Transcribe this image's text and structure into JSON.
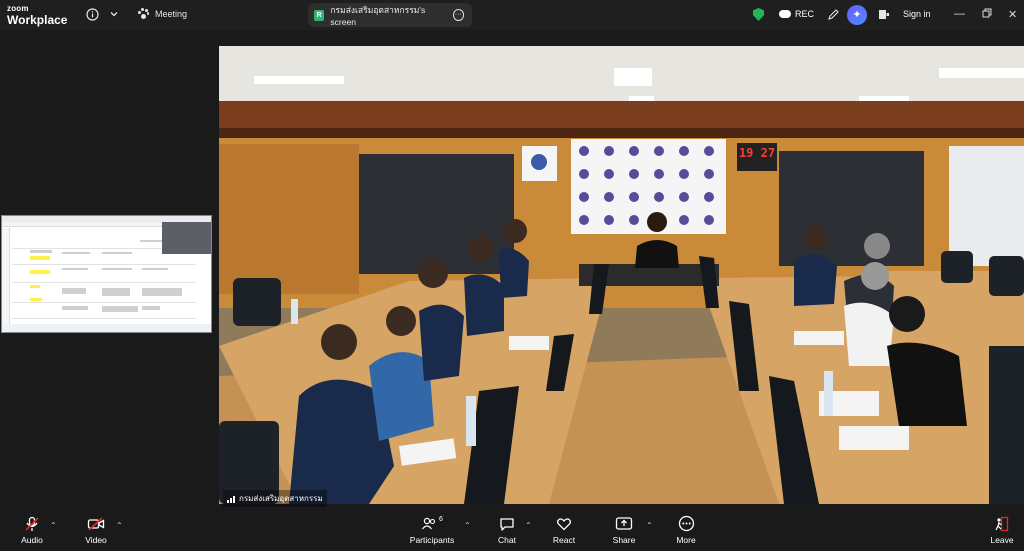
{
  "app": {
    "logo_line1": "zoom",
    "logo_line2": "Workplace"
  },
  "topbar": {
    "meeting_label": "Meeting",
    "share_badge": "R",
    "share_title": "กรมส่งเสริมอุตสาหกรรม's screen",
    "rec_label": "REC",
    "sign_in": "Sign in"
  },
  "video": {
    "participant_name": "กรมส่งเสริมอุตสาหกรรม",
    "clock": "19 27"
  },
  "toolbar": {
    "audio": "Audio",
    "video": "Video",
    "participants": "Participants",
    "participants_count": "6",
    "chat": "Chat",
    "react": "React",
    "share": "Share",
    "more": "More",
    "leave": "Leave"
  },
  "colors": {
    "accent": "#2D8CFF",
    "shield": "#23B35B",
    "mute_red": "#E02828"
  }
}
